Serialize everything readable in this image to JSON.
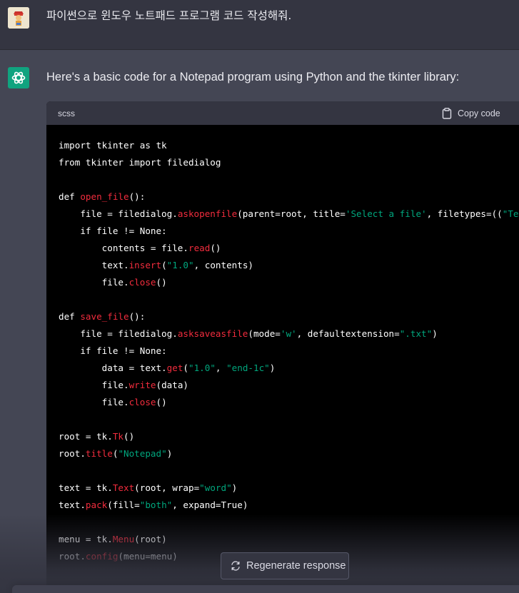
{
  "user_message": {
    "avatar_icon": "user-avatar-icon",
    "text": "파이썬으로 윈도우 노트패드 프로그램 코드 작성해줘."
  },
  "assistant_message": {
    "avatar_icon": "openai-logo-icon",
    "intro": "Here's a basic code for a Notepad program using Python and the tkinter library:",
    "code_block": {
      "language": "scss",
      "copy_label": "Copy code",
      "lines": [
        [
          [
            "import tkinter as tk",
            ""
          ]
        ],
        [
          [
            "from tkinter import filedialog",
            ""
          ]
        ],
        [],
        [
          [
            "def ",
            ""
          ],
          [
            "open_file",
            "fn"
          ],
          [
            "():",
            ""
          ]
        ],
        [
          [
            "    file = filedialog.",
            ""
          ],
          [
            "askopenfile",
            "fn"
          ],
          [
            "(parent=root, title=",
            ""
          ],
          [
            "'Select a file'",
            "str"
          ],
          [
            ", filetypes=((",
            ""
          ],
          [
            "\"Text files\"",
            "str"
          ]
        ],
        [
          [
            "    if file != None:",
            ""
          ]
        ],
        [
          [
            "        contents = file.",
            ""
          ],
          [
            "read",
            "fn"
          ],
          [
            "()",
            ""
          ]
        ],
        [
          [
            "        text.",
            ""
          ],
          [
            "insert",
            "fn"
          ],
          [
            "(",
            ""
          ],
          [
            "\"1.0\"",
            "str"
          ],
          [
            ", contents)",
            ""
          ]
        ],
        [
          [
            "        file.",
            ""
          ],
          [
            "close",
            "fn"
          ],
          [
            "()",
            ""
          ]
        ],
        [],
        [
          [
            "def ",
            ""
          ],
          [
            "save_file",
            "fn"
          ],
          [
            "():",
            ""
          ]
        ],
        [
          [
            "    file = filedialog.",
            ""
          ],
          [
            "asksaveasfile",
            "fn"
          ],
          [
            "(mode=",
            ""
          ],
          [
            "'w'",
            "str"
          ],
          [
            ", defaultextension=",
            ""
          ],
          [
            "\".txt\"",
            "str"
          ],
          [
            ")",
            ""
          ]
        ],
        [
          [
            "    if file != None:",
            ""
          ]
        ],
        [
          [
            "        data = text.",
            ""
          ],
          [
            "get",
            "fn"
          ],
          [
            "(",
            ""
          ],
          [
            "\"1.0\"",
            "str"
          ],
          [
            ", ",
            ""
          ],
          [
            "\"end-1c\"",
            "str"
          ],
          [
            ")",
            ""
          ]
        ],
        [
          [
            "        file.",
            ""
          ],
          [
            "write",
            "fn"
          ],
          [
            "(data)",
            ""
          ]
        ],
        [
          [
            "        file.",
            ""
          ],
          [
            "close",
            "fn"
          ],
          [
            "()",
            ""
          ]
        ],
        [],
        [
          [
            "root = tk.",
            ""
          ],
          [
            "Tk",
            "fn"
          ],
          [
            "()",
            ""
          ]
        ],
        [
          [
            "root.",
            ""
          ],
          [
            "title",
            "fn"
          ],
          [
            "(",
            ""
          ],
          [
            "\"Notepad\"",
            "str"
          ],
          [
            ")",
            ""
          ]
        ],
        [],
        [
          [
            "text = tk.",
            ""
          ],
          [
            "Text",
            "fn"
          ],
          [
            "(root, wrap=",
            ""
          ],
          [
            "\"word\"",
            "str"
          ],
          [
            ")",
            ""
          ]
        ],
        [
          [
            "text.",
            ""
          ],
          [
            "pack",
            "fn"
          ],
          [
            "(fill=",
            ""
          ],
          [
            "\"both\"",
            "str"
          ],
          [
            ", expand=True)",
            ""
          ]
        ],
        [],
        [
          [
            "menu = tk.",
            ""
          ],
          [
            "Menu",
            "fn"
          ],
          [
            "(root)",
            ""
          ]
        ],
        [
          [
            "root.",
            ""
          ],
          [
            "config",
            "fn"
          ],
          [
            "(menu=menu)",
            ""
          ]
        ]
      ]
    }
  },
  "regenerate": {
    "icon": "refresh-icon",
    "label": "Regenerate response"
  },
  "colors": {
    "page_bg": "#343541",
    "assistant_bg": "#444654",
    "code_bg": "#000000",
    "keyword_fn": "#f22c3d",
    "string": "#00a67d",
    "brand": "#10a37f"
  }
}
